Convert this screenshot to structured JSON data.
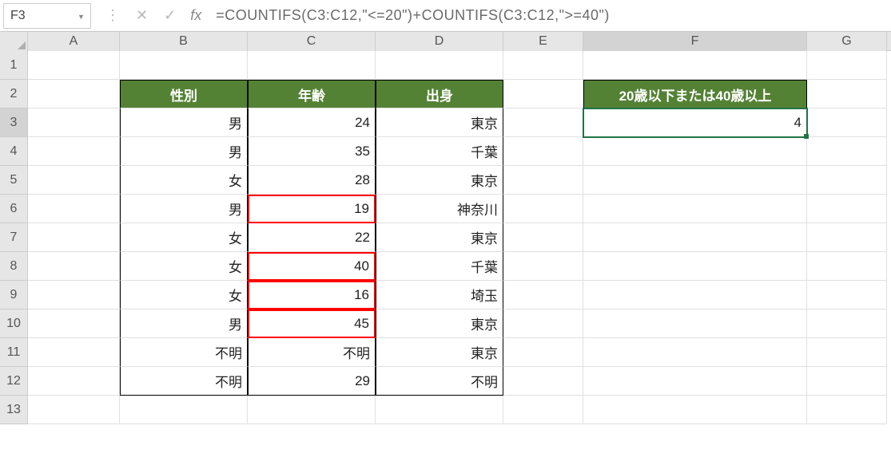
{
  "nameBox": "F3",
  "formula": "=COUNTIFS(C3:C12,\"<=20\")+COUNTIFS(C3:C12,\">=40\")",
  "fx": "fx",
  "cols": [
    "A",
    "B",
    "C",
    "D",
    "E",
    "F",
    "G"
  ],
  "rows": [
    "1",
    "2",
    "3",
    "4",
    "5",
    "6",
    "7",
    "8",
    "9",
    "10",
    "11",
    "12",
    "13"
  ],
  "headers": {
    "B": "性別",
    "C": "年齢",
    "D": "出身"
  },
  "f2": "20歳以下または40歳以上",
  "f3": "4",
  "table": [
    {
      "b": "男",
      "c": "24",
      "d": "東京"
    },
    {
      "b": "男",
      "c": "35",
      "d": "千葉"
    },
    {
      "b": "女",
      "c": "28",
      "d": "東京"
    },
    {
      "b": "男",
      "c": "19",
      "d": "神奈川"
    },
    {
      "b": "女",
      "c": "22",
      "d": "東京"
    },
    {
      "b": "女",
      "c": "40",
      "d": "千葉"
    },
    {
      "b": "女",
      "c": "16",
      "d": "埼玉"
    },
    {
      "b": "男",
      "c": "45",
      "d": "東京"
    },
    {
      "b": "不明",
      "c": "不明",
      "d": "東京"
    },
    {
      "b": "不明",
      "c": "29",
      "d": "不明"
    }
  ],
  "redRows": [
    3,
    5,
    6,
    7
  ]
}
